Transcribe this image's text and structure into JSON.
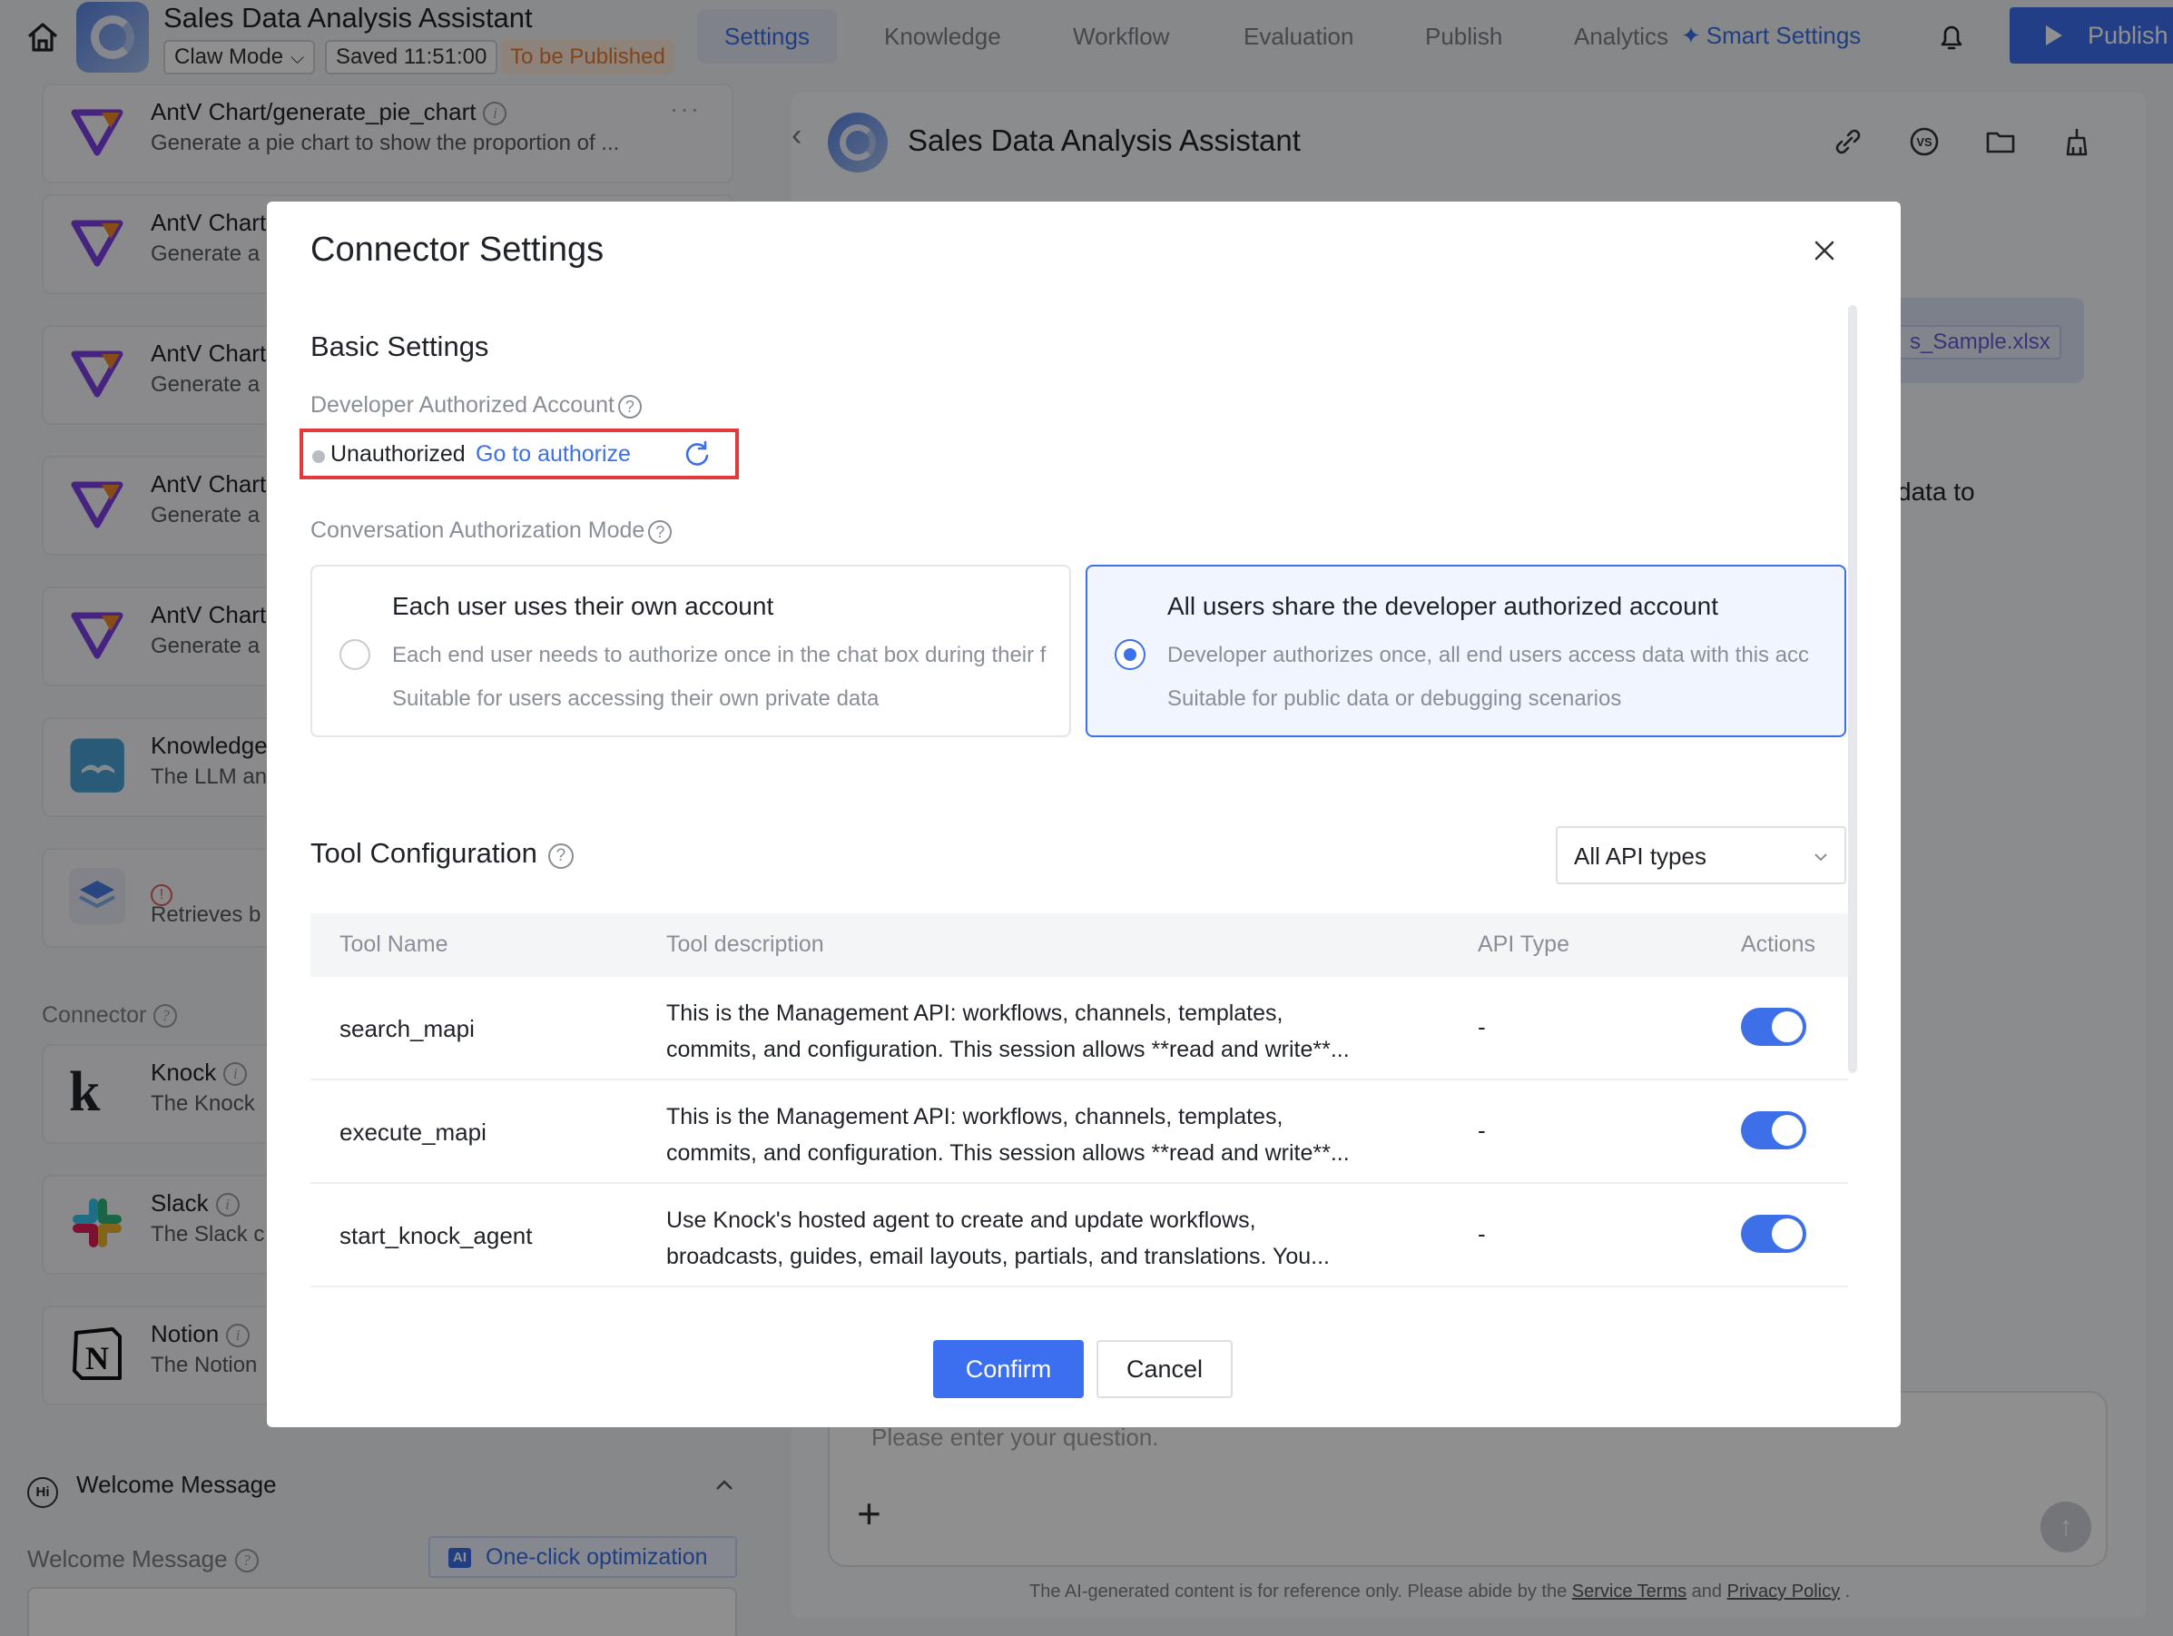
{
  "app": {
    "title": "Sales Data Analysis Assistant",
    "mode": "Claw Mode",
    "saved": "Saved 11:51:00",
    "status": "To be Published"
  },
  "nav": {
    "tabs": [
      "Settings",
      "Knowledge",
      "Workflow",
      "Evaluation",
      "Publish",
      "Analytics"
    ],
    "active": "Settings",
    "smart_settings": "Smart Settings",
    "publish_button": "Publish"
  },
  "left": {
    "tools": [
      {
        "title": "AntV Chart/generate_pie_chart",
        "desc": "Generate a pie chart to show the proportion of ..."
      },
      {
        "title": "AntV Chart",
        "desc": "Generate a"
      },
      {
        "title": "AntV Chart",
        "desc": "Generate a"
      },
      {
        "title": "AntV Chart",
        "desc": "Generate a"
      },
      {
        "title": "AntV Chart",
        "desc": "Generate a"
      },
      {
        "title": "Knowledge",
        "desc": "The LLM an"
      },
      {
        "title": "",
        "desc": "Retrieves b"
      }
    ],
    "connector_label": "Connector",
    "connectors": [
      {
        "title": "Knock",
        "desc": "The Knock"
      },
      {
        "title": "Slack",
        "desc": "The Slack c"
      },
      {
        "title": "Notion",
        "desc": "The Notion"
      }
    ],
    "welcome_title": "Welcome Message",
    "welcome_label": "Welcome Message",
    "oneclick": "One-click optimization",
    "ai_badge": "AI"
  },
  "right": {
    "title": "Sales Data Analysis Assistant",
    "file_chip": "s_Sample.xlsx",
    "chat_fragment": "data to",
    "input_placeholder": "Please enter your question.",
    "disclaimer_pre": "The AI-generated content is for reference only. Please abide by the",
    "service_terms": "Service Terms",
    "and": "and",
    "privacy_policy": "Privacy Policy",
    "period": "."
  },
  "modal": {
    "title": "Connector Settings",
    "basic_settings": "Basic Settings",
    "dev_account_label": "Developer Authorized Account",
    "unauthorized": "Unauthorized",
    "go_authorize": "Go to authorize",
    "conv_mode_label": "Conversation Authorization Mode",
    "modes": [
      {
        "title": "Each user uses their own account",
        "line1": "Each end user needs to authorize once in the chat box during their f",
        "line2": "Suitable for users accessing their own private data",
        "selected": false
      },
      {
        "title": "All users share the developer authorized account",
        "line1": "Developer authorizes once, all end users access data with this acc",
        "line2": "Suitable for public data or debugging scenarios",
        "selected": true
      }
    ],
    "tool_config": "Tool Configuration",
    "api_filter": "All API types",
    "columns": [
      "Tool Name",
      "Tool description",
      "API Type",
      "Actions"
    ],
    "rows": [
      {
        "name": "search_mapi",
        "desc1": "This is the Management API: workflows, channels, templates,",
        "desc2": "commits, and configuration. This session allows **read and write**...",
        "api": "-",
        "enabled": true
      },
      {
        "name": "execute_mapi",
        "desc1": "This is the Management API: workflows, channels, templates,",
        "desc2": "commits, and configuration. This session allows **read and write**...",
        "api": "-",
        "enabled": true
      },
      {
        "name": "start_knock_agent",
        "desc1": "Use Knock's hosted agent to create and update workflows,",
        "desc2": "broadcasts, guides, email layouts, partials, and translations. You...",
        "api": "-",
        "enabled": true
      }
    ],
    "confirm": "Confirm",
    "cancel": "Cancel"
  },
  "colors": {
    "accent": "#3c6ff0",
    "status_orange": "#e8792b",
    "highlight_red": "#e23a3a"
  }
}
